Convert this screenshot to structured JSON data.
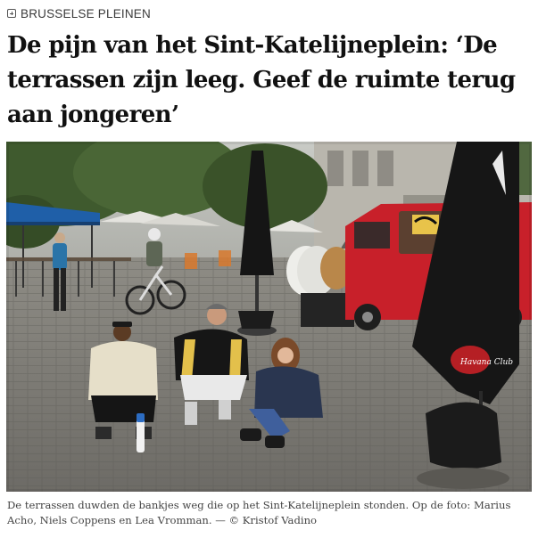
{
  "article": {
    "section_label": "BRUSSELSE PLEINEN",
    "section_icon": "plus-square-icon",
    "headline": "De pijn van het Sint-Katelijneplein: ‘De terrassen zijn leeg. Geef de ruimte terug aan jongeren’",
    "caption": "De terrassen duwden de bankjes weg die op het Sint-Katelijneplein stonden. Op de foto: Marius Acho, Niels Coppens en Lea Vromman. — © Kristof Vadino"
  },
  "photo": {
    "signage": {
      "bottle_label": "Havana Club",
      "van_logo": "Havana",
      "umbrella_mark": "H"
    },
    "colors": {
      "van_red": "#c8202a",
      "awning_blue": "#1f5fa8",
      "cobblestone": "#7f7d77",
      "foliage": "#3f5a2e"
    }
  }
}
